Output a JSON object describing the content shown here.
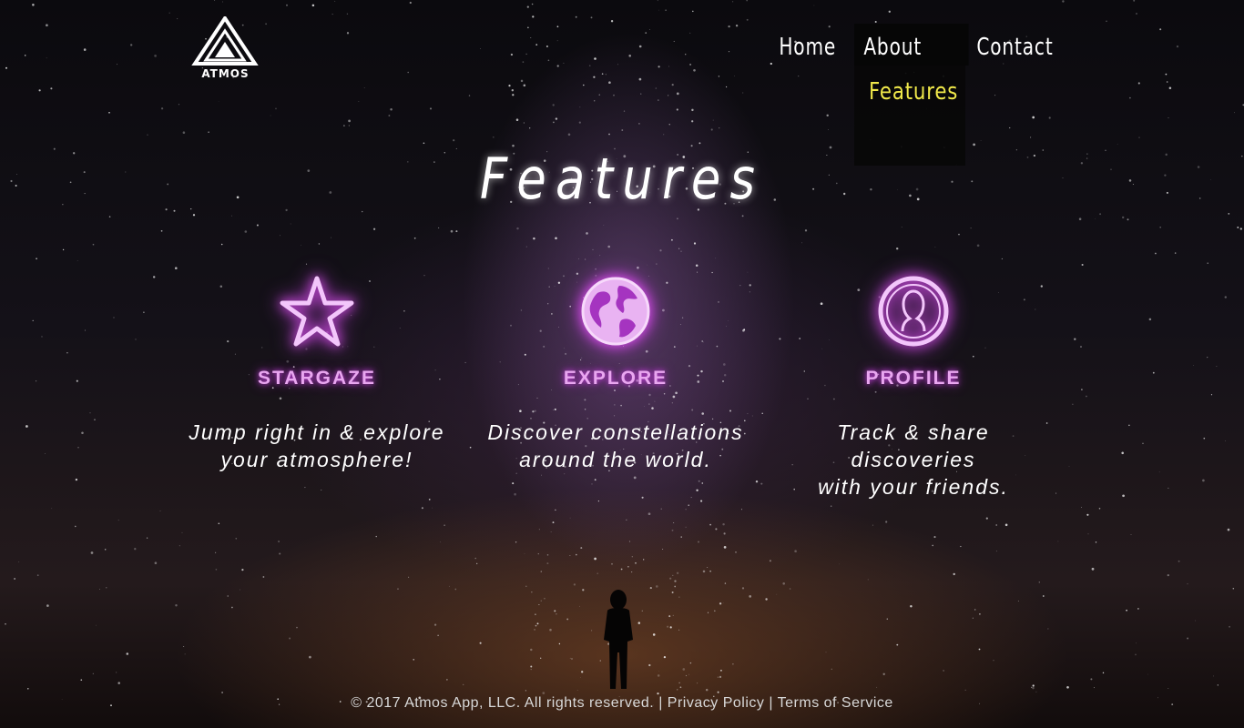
{
  "logo": {
    "text": "ATMOS"
  },
  "nav": {
    "home": "Home",
    "about": "About",
    "contact": "Contact",
    "dropdown_features": "Features"
  },
  "page_title": "Features",
  "features": [
    {
      "icon": "star-icon",
      "label": "STARGAZE",
      "desc_line1": "Jump right in & explore",
      "desc_line2": "your atmosphere!"
    },
    {
      "icon": "globe-icon",
      "label": "EXPLORE",
      "desc_line1": "Discover constellations",
      "desc_line2": "around the world."
    },
    {
      "icon": "profile-icon",
      "label": "PROFILE",
      "desc_line1": "Track & share discoveries",
      "desc_line2": "with your friends."
    }
  ],
  "footer": {
    "copyright": "© 2017 Atmos App, LLC. All rights reserved.",
    "sep1": "|",
    "privacy": "Privacy Policy",
    "sep2": "|",
    "terms": "Terms of Service"
  },
  "colors": {
    "accent_glow": "#d44ee6",
    "dropdown_text": "#f0e84a"
  }
}
